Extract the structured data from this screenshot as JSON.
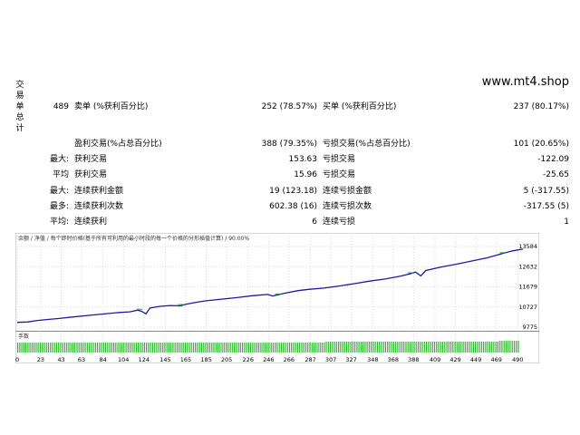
{
  "side_label": [
    "交",
    "易",
    "单",
    "总",
    "计"
  ],
  "watermark": "www.mt4.shop",
  "stats": {
    "total_trades": "489",
    "short_label": "卖单 (%获利百分比)",
    "short_value": "252 (78.57%)",
    "long_label": "买单 (%获利百分比)",
    "long_value": "237 (80.17%)",
    "profit_trades_label": "盈利交易(%占总百分比)",
    "profit_trades_value": "388 (79.35%)",
    "loss_trades_label": "亏损交易(%占总百分比)",
    "loss_trades_value": "101 (20.65%)",
    "max_label": "最大:",
    "max_profit_label": "获利交易",
    "max_profit_value": "153.63",
    "max_loss_label": "亏损交易",
    "max_loss_value": "-122.09",
    "avg_label": "平均",
    "avg_profit_label": "获利交易",
    "avg_profit_value": "15.96",
    "avg_loss_label": "亏损交易",
    "avg_loss_value": "-25.65",
    "max2_label": "最大:",
    "max_consec_win_amt_label": "连续获利金额",
    "max_consec_win_amt_value": "19 (123.18)",
    "max_consec_loss_amt_label": "连续亏损金额",
    "max_consec_loss_amt_value": "5 (-317.55)",
    "max3_label": "最多:",
    "max_consec_win_cnt_label": "连续获利次数",
    "max_consec_win_cnt_value": "602.38 (16)",
    "max_consec_loss_cnt_label": "连续亏损次数",
    "max_consec_loss_cnt_value": "-317.55 (5)",
    "avg2_label": "平均:",
    "avg_consec_win_label": "连续获利",
    "avg_consec_win_value": "6",
    "avg_consec_loss_label": "连续亏损",
    "avg_consec_loss_value": "1"
  },
  "chart_legend": "余额 / 净值 / 每个即时价格(基于所有可利用的最小时段的每一个价格的分形插值计算) / 90.00%",
  "chart_colors": {
    "balance": "#1a1aa6",
    "equity": "#2e9e2e",
    "volume": "#2fb52f"
  },
  "volume_label": "手数",
  "chart_data": {
    "type": "line",
    "x_ticks": [
      "0",
      "23",
      "43",
      "63",
      "84",
      "104",
      "124",
      "145",
      "165",
      "185",
      "205",
      "226",
      "246",
      "266",
      "287",
      "307",
      "327",
      "348",
      "368",
      "388",
      "409",
      "429",
      "449",
      "469",
      "490"
    ],
    "y_ticks": [
      "13584",
      "12632",
      "11679",
      "10727",
      "9775"
    ],
    "ylim": [
      9775,
      13800
    ],
    "xlim": [
      0,
      495
    ],
    "series": [
      {
        "values": [
          [
            0,
            10000
          ],
          [
            10,
            10020
          ],
          [
            20,
            10090
          ],
          [
            30,
            10140
          ],
          [
            40,
            10180
          ],
          [
            55,
            10260
          ],
          [
            70,
            10330
          ],
          [
            85,
            10400
          ],
          [
            100,
            10470
          ],
          [
            110,
            10500
          ],
          [
            118,
            10580
          ],
          [
            122,
            10520
          ],
          [
            126,
            10400
          ],
          [
            130,
            10680
          ],
          [
            140,
            10760
          ],
          [
            150,
            10800
          ],
          [
            160,
            10780
          ],
          [
            165,
            10860
          ],
          [
            175,
            10950
          ],
          [
            185,
            11020
          ],
          [
            200,
            11100
          ],
          [
            215,
            11170
          ],
          [
            230,
            11260
          ],
          [
            245,
            11320
          ],
          [
            250,
            11250
          ],
          [
            255,
            11300
          ],
          [
            262,
            11380
          ],
          [
            275,
            11500
          ],
          [
            285,
            11560
          ],
          [
            300,
            11620
          ],
          [
            315,
            11720
          ],
          [
            330,
            11830
          ],
          [
            345,
            11950
          ],
          [
            360,
            12050
          ],
          [
            375,
            12180
          ],
          [
            385,
            12300
          ],
          [
            390,
            12380
          ],
          [
            395,
            12200
          ],
          [
            400,
            12450
          ],
          [
            415,
            12620
          ],
          [
            430,
            12750
          ],
          [
            445,
            12900
          ],
          [
            460,
            13050
          ],
          [
            475,
            13250
          ],
          [
            485,
            13380
          ],
          [
            495,
            13460
          ]
        ]
      }
    ]
  }
}
